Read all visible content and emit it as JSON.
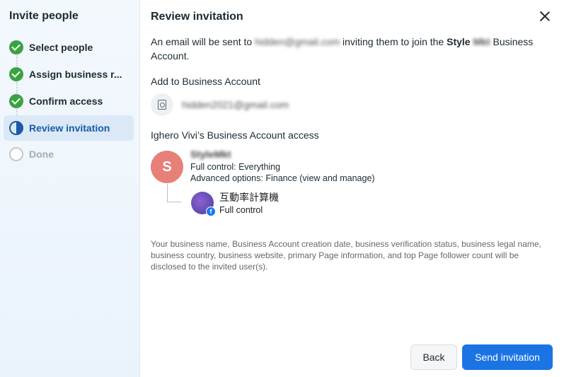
{
  "sidebar": {
    "title": "Invite people",
    "steps": [
      {
        "label": "Select people",
        "state": "done"
      },
      {
        "label": "Assign business r...",
        "state": "done"
      },
      {
        "label": "Confirm access",
        "state": "done"
      },
      {
        "label": "Review invitation",
        "state": "active"
      },
      {
        "label": "Done",
        "state": "pending"
      }
    ]
  },
  "main": {
    "title": "Review invitation",
    "intro": {
      "prefix": "An email will be sent to",
      "email_redacted": "hidden@gmail.com",
      "middle": "inviting them to join the",
      "account_name_part1": "Style",
      "account_name_part2_redacted": "Mkt",
      "suffix": "Business Account."
    },
    "add_to_label": "Add to Business Account",
    "account_row_redacted": "hidden2021@gmail.com",
    "access_label": "Ighero Vivi’s Business Account access",
    "business": {
      "avatar_letter": "S",
      "name_redacted": "StyleMkt",
      "full_control": "Full control: Everything",
      "advanced_options": "Advanced options: Finance (view and manage)"
    },
    "page": {
      "name": "互動率計算機",
      "control": "Full control"
    },
    "disclaimer": "Your business name, Business Account creation date, business verification status, business legal name, business country, business website, primary Page information, and top Page follower count will be disclosed to the invited user(s).",
    "buttons": {
      "back": "Back",
      "send": "Send invitation"
    }
  },
  "colors": {
    "accent": "#1b74e4",
    "success": "#3aa340",
    "avatar": "#e8807a"
  }
}
